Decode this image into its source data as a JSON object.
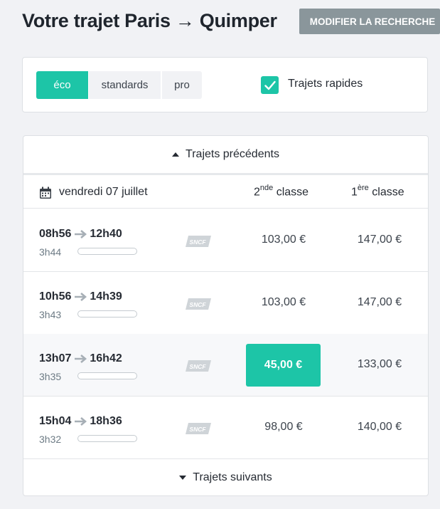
{
  "header": {
    "title": "Votre trajet Paris → Quimper",
    "modify_label": "MODIFIER LA RECHERCHE"
  },
  "filters": {
    "segments": [
      "éco",
      "standards",
      "pro"
    ],
    "active_segment": "éco",
    "checkbox_label": "Trajets rapides",
    "checkbox_checked": true
  },
  "results": {
    "prev_label": "Trajets précédents",
    "next_label": "Trajets suivants",
    "date_label": "vendredi 07 juillet",
    "col_second": {
      "prefix": "2",
      "sup": "nde",
      "suffix": " classe"
    },
    "col_first": {
      "prefix": "1",
      "sup": "ère",
      "suffix": " classe"
    },
    "carrier": "SNCF",
    "trips": [
      {
        "depart": "08h56",
        "arrive": "12h40",
        "duration": "3h44",
        "price_2nd": "103,00 €",
        "price_1st": "147,00 €"
      },
      {
        "depart": "10h56",
        "arrive": "14h39",
        "duration": "3h43",
        "price_2nd": "103,00 €",
        "price_1st": "147,00 €"
      },
      {
        "depart": "13h07",
        "arrive": "16h42",
        "duration": "3h35",
        "price_2nd": "45,00 €",
        "price_1st": "133,00 €"
      },
      {
        "depart": "15h04",
        "arrive": "18h36",
        "duration": "3h32",
        "price_2nd": "98,00 €",
        "price_1st": "140,00 €"
      }
    ]
  },
  "colors": {
    "accent": "#1dc5a7",
    "button_grey": "#8a969b"
  }
}
